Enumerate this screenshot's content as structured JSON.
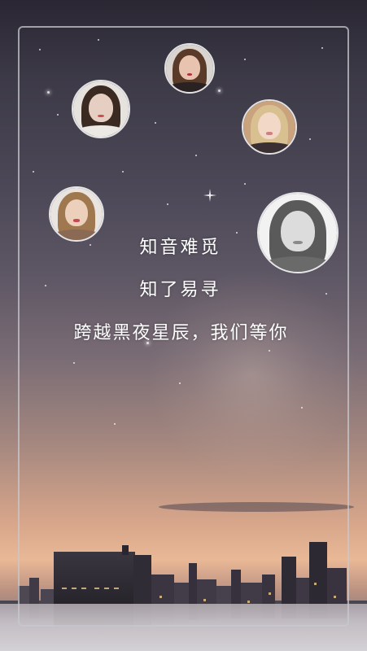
{
  "poem": {
    "line1": "知音难觅",
    "line2": "知了易寻",
    "line3": "跨越黑夜星辰，我们等你"
  },
  "avatars": [
    {
      "name": "avatar-top-center",
      "hair": "#5a3a28",
      "skin": "#e8c4b0",
      "bg": "#d9d4cf",
      "lips": "#b0303a",
      "shoulders": "#2a2222"
    },
    {
      "name": "avatar-upper-left",
      "hair": "#3b2a22",
      "skin": "#e6cfc2",
      "bg": "#e6e2de",
      "lips": "#c25050",
      "shoulders": "#ece8e4"
    },
    {
      "name": "avatar-upper-right",
      "hair": "#d8c090",
      "skin": "#f2d8c6",
      "bg": "#c9a27e",
      "lips": "#d08080",
      "shoulders": "#3a2f33"
    },
    {
      "name": "avatar-middle-left",
      "hair": "#a07850",
      "skin": "#edd0bc",
      "bg": "#e9e4e0",
      "lips": "#c84a50",
      "shoulders": "#8a6a55"
    },
    {
      "name": "avatar-middle-right",
      "hair": "#5a5a5a",
      "skin": "#dcdcdc",
      "bg": "#f2f2f2",
      "lips": "#8a8a8a",
      "shoulders": "#6a6a6a"
    }
  ]
}
